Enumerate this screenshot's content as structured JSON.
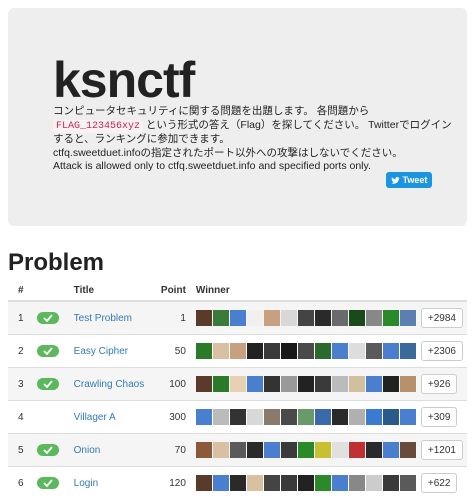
{
  "header": {
    "title": "ksnctf",
    "desc_line1": "コンピュータセキュリティに関する問題を出題します。 各問題から",
    "flag_example": "FLAG_123456xyz",
    "desc_line2_rest": " という形式の答え（Flag）を探してください。 Twitterでログイン",
    "desc_line3": "すると、ランキングに参加できます。",
    "desc_line4": "ctfq.sweetduet.infoの指定されたポート以外への攻撃はしないでください。",
    "desc_line5": "Attack is allowed only to ctfq.sweetduet.info and specified ports only.",
    "tweet_label": "Tweet"
  },
  "problems": {
    "heading": "Problem",
    "columns": {
      "num": "#",
      "title": "Title",
      "point": "Point",
      "winner": "Winner"
    },
    "rows": [
      {
        "num": "1",
        "solved": true,
        "title": "Test Problem",
        "point": "1",
        "more": "+2984",
        "avatars": [
          "#5a3a2a",
          "#3a7a3a",
          "#4a7fd0",
          "#f0f0f0",
          "#c8a080",
          "#d8d8d8",
          "#444444",
          "#2a2a2a",
          "#6a6a6a",
          "#1a4a1a",
          "#888888",
          "#2a8a2a",
          "#5a7fb0"
        ]
      },
      {
        "num": "2",
        "solved": true,
        "title": "Easy Cipher",
        "point": "50",
        "more": "+2306",
        "avatars": [
          "#2a7a2a",
          "#d8c0a0",
          "#c8a080",
          "#222222",
          "#3a3a3a",
          "#1a1a1a",
          "#4a4a4a",
          "#2a6a2a",
          "#4a7fd0",
          "#dddddd",
          "#5a5a5a",
          "#4a7fd0",
          "#3a6a9a"
        ]
      },
      {
        "num": "3",
        "solved": true,
        "title": "Crawling Chaos",
        "point": "100",
        "more": "+926",
        "avatars": [
          "#5a3a2a",
          "#2a7a2a",
          "#e8d0b0",
          "#4a7fd0",
          "#333333",
          "#999999",
          "#222222",
          "#3a3a3a",
          "#bbbbbb",
          "#d0c0a0",
          "#4a7fd0",
          "#222222",
          "#b8906a"
        ]
      },
      {
        "num": "4",
        "solved": false,
        "title": "Villager A",
        "point": "300",
        "more": "+309",
        "avatars": [
          "#4a7fd0",
          "#bbbbbb",
          "#333333",
          "#d8d8d8",
          "#8a7a6a",
          "#4a4a4a",
          "#6a9a6a",
          "#3a6aaa",
          "#2a2a2a",
          "#b0b0b0",
          "#3a7ad0",
          "#2a5a8a",
          "#4a7fd0"
        ]
      },
      {
        "num": "5",
        "solved": true,
        "title": "Onion",
        "point": "70",
        "more": "+1201",
        "avatars": [
          "#8a5a3a",
          "#d8c0a0",
          "#5a5a5a",
          "#2a2a2a",
          "#4a7fd0",
          "#3a3a3a",
          "#2a8a2a",
          "#c8c030",
          "#e0e0e0",
          "#c03030",
          "#2a2a2a",
          "#4a7fd0",
          "#6a4a3a"
        ]
      },
      {
        "num": "6",
        "solved": true,
        "title": "Login",
        "point": "120",
        "more": "+622",
        "avatars": [
          "#5a3a2a",
          "#4a7fd0",
          "#2a2a2a",
          "#d8c0a0",
          "#444444",
          "#3a3a3a",
          "#222222",
          "#2a8a2a",
          "#4a7fd0",
          "#888888",
          "#cccccc",
          "#3a3a3a",
          "#5a5a5a"
        ]
      }
    ]
  }
}
